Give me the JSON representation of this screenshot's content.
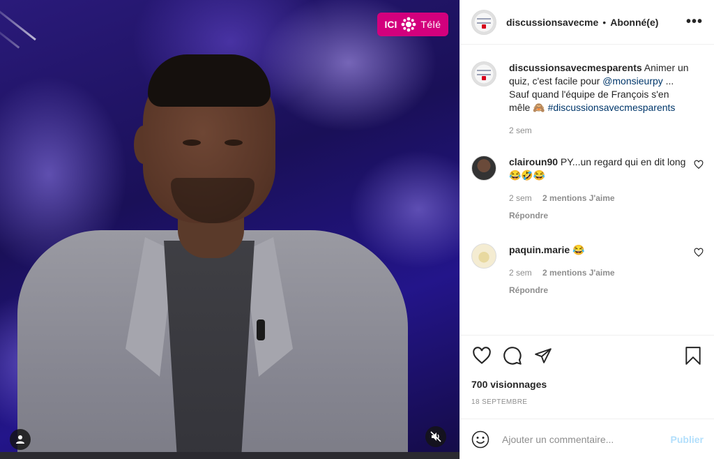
{
  "video": {
    "brand_logo": {
      "left": "ICI",
      "right": "Télé",
      "color": "#d3007d"
    },
    "controls": {
      "user_icon": "person-icon",
      "mute_icon": "speaker-muted-icon"
    }
  },
  "header": {
    "username": "discussionsavecme",
    "separator": "•",
    "follow_status": "Abonné(e)",
    "more_label": "•••"
  },
  "caption": {
    "username": "discussionsavecmesparents",
    "text_before": "Animer un quiz, c'est facile pour",
    "mention": "@monsieurpy",
    "text_after": "... Sauf quand l'équipe de François s'en mêle 🙈",
    "hashtag": "#discussionsavecmesparents",
    "time": "2 sem"
  },
  "comments": [
    {
      "username": "clairoun90",
      "text": "PY...un regard qui en dit long 😂🤣😂",
      "time": "2 sem",
      "likes": "2 mentions J'aime",
      "reply": "Répondre"
    },
    {
      "username": "paquin.marie",
      "text": "😂",
      "time": "2 sem",
      "likes": "2 mentions J'aime",
      "reply": "Répondre"
    }
  ],
  "actions": {
    "icons": [
      "heart-icon",
      "comment-icon",
      "share-icon",
      "bookmark-icon"
    ],
    "views": "700 visionnages",
    "date": "18 SEPTEMBRE"
  },
  "add_comment": {
    "placeholder": "Ajouter un commentaire...",
    "publish_label": "Publier"
  },
  "colors": {
    "link": "#00376b",
    "muted": "#8e8e8e",
    "publish_disabled": "#b2dffc"
  }
}
